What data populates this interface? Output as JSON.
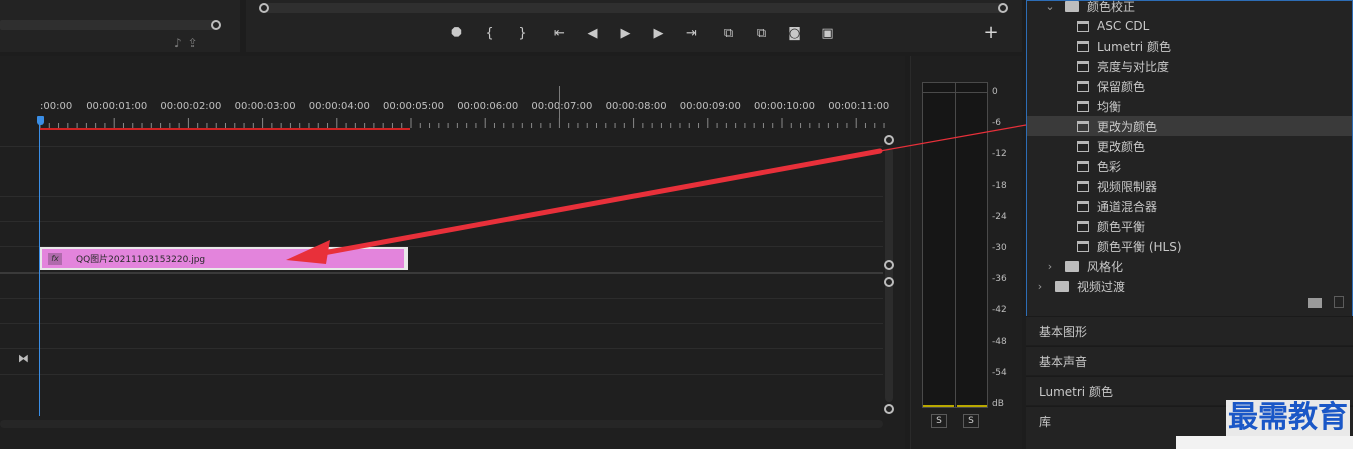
{
  "colors": {
    "accent_blue": "#2d6db6",
    "playhead": "#3a8ee6",
    "work_area": "#d02424",
    "clip_fill": "#e384dc",
    "annotation_arrow": "#e8303a",
    "watermark": "#1a57c7"
  },
  "source_monitor": {
    "icons": [
      "audio-drag-icon",
      "export-icon"
    ]
  },
  "program_monitor": {
    "controls": [
      {
        "name": "marker-icon",
        "glyph": "⯃"
      },
      {
        "name": "mark-in-icon",
        "glyph": "{"
      },
      {
        "name": "mark-out-icon",
        "glyph": "}"
      },
      {
        "name": "go-to-in-icon",
        "glyph": "⇤"
      },
      {
        "name": "step-back-icon",
        "glyph": "◀"
      },
      {
        "name": "play-icon",
        "glyph": "▶"
      },
      {
        "name": "step-forward-icon",
        "glyph": "▶"
      },
      {
        "name": "go-to-out-icon",
        "glyph": "⇥"
      },
      {
        "name": "lift-icon",
        "glyph": "⧉"
      },
      {
        "name": "extract-icon",
        "glyph": "⧉"
      },
      {
        "name": "camera-icon",
        "glyph": "◙"
      },
      {
        "name": "compare-icon",
        "glyph": "▣"
      }
    ],
    "add_glyph": "+"
  },
  "timeline": {
    "timecodes": [
      ":00:00",
      "00:00:01:00",
      "00:00:02:00",
      "00:00:03:00",
      "00:00:04:00",
      "00:00:05:00",
      "00:00:06:00",
      "00:00:07:00",
      "00:00:08:00",
      "00:00:09:00",
      "00:00:10:00",
      "00:00:11:00"
    ],
    "clip": {
      "fx": "fx",
      "name": "QQ图片20211103153220.jpg"
    }
  },
  "audio_meter": {
    "db_labels": [
      "0",
      "-6",
      "-12",
      "-18",
      "-24",
      "-30",
      "-36",
      "-42",
      "-48",
      "-54",
      "dB"
    ],
    "solo_left": "S",
    "solo_right": "S"
  },
  "effects_panel": {
    "items": [
      {
        "label": "颜色校正",
        "type": "folder-open",
        "indent": 1
      },
      {
        "label": "ASC CDL",
        "type": "preset",
        "indent": 2
      },
      {
        "label": "Lumetri 颜色",
        "type": "preset",
        "indent": 2
      },
      {
        "label": "亮度与对比度",
        "type": "preset",
        "indent": 2
      },
      {
        "label": "保留颜色",
        "type": "preset",
        "indent": 2
      },
      {
        "label": "均衡",
        "type": "preset",
        "indent": 2
      },
      {
        "label": "更改为颜色",
        "type": "preset",
        "indent": 2,
        "selected": true
      },
      {
        "label": "更改颜色",
        "type": "preset",
        "indent": 2
      },
      {
        "label": "色彩",
        "type": "preset",
        "indent": 2
      },
      {
        "label": "视频限制器",
        "type": "preset",
        "indent": 2
      },
      {
        "label": "通道混合器",
        "type": "preset",
        "indent": 2
      },
      {
        "label": "颜色平衡",
        "type": "preset",
        "indent": 2
      },
      {
        "label": "颜色平衡 (HLS)",
        "type": "preset",
        "indent": 2
      },
      {
        "label": "风格化",
        "type": "folder",
        "indent": 1
      },
      {
        "label": "视频过渡",
        "type": "folder",
        "indent": 0
      }
    ]
  },
  "panel_tabs": [
    "基本图形",
    "基本声音",
    "Lumetri 颜色",
    "库"
  ],
  "watermark": "最需教育"
}
